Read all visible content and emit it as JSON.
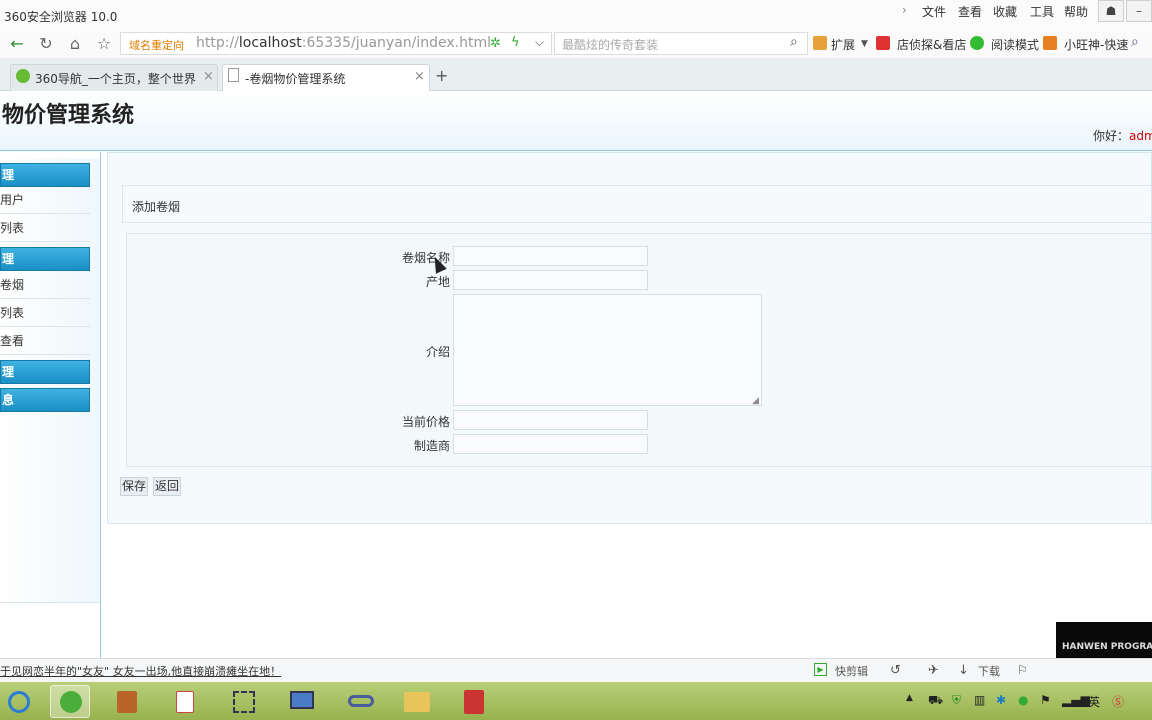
{
  "browser": {
    "app_title": "360安全浏览器 10.0",
    "menu": [
      "文件",
      "查看",
      "收藏",
      "工具",
      "帮助"
    ],
    "url_tag": "域名重定向",
    "url_prefix": "http://",
    "url_host": "localhost",
    "url_rest": ":65335/juanyan/index.html",
    "search_placeholder": "最酷炫的传奇套装",
    "toolbar": [
      "扩展",
      "店侦探&看店",
      "阅读模式",
      "小旺神-快速"
    ],
    "tabs": [
      {
        "label": "360导航_一个主页，整个世界",
        "active": false
      },
      {
        "label": "-卷烟物价管理系统",
        "active": true
      }
    ]
  },
  "header": {
    "title": "物价管理系统",
    "greeting_prefix": "你好：",
    "greeting_user": "adm"
  },
  "sidebar": {
    "groups": [
      {
        "label": "理",
        "items": [
          "用户",
          "列表"
        ]
      },
      {
        "label": "理",
        "items": [
          "卷烟",
          "列表",
          "查看"
        ]
      },
      {
        "label": "理",
        "items": []
      },
      {
        "label": "息",
        "items": []
      }
    ]
  },
  "form": {
    "title": "添加卷烟",
    "fields": {
      "name": "卷烟名称",
      "origin": "产地",
      "intro": "介绍",
      "price": "当前价格",
      "maker": "制造商"
    },
    "save": "保存",
    "back": "返回"
  },
  "statusbar": {
    "news": "于见网恋半年的\"女友\" 女友一出场,他直接崩溃瘫坐在地！",
    "items": [
      "快剪辑",
      "下载"
    ]
  },
  "logo_text": "HANWEN PROGRAMMING",
  "taskbar": {
    "lang": "英"
  }
}
